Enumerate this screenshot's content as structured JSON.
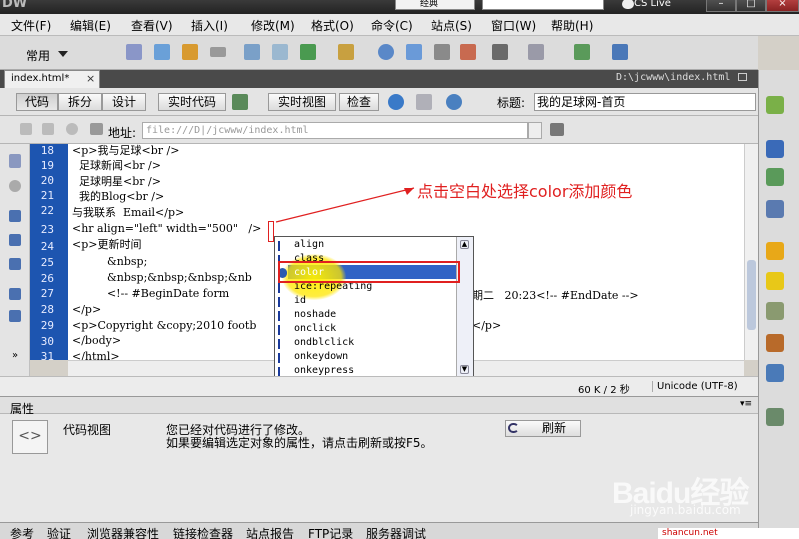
{
  "app": {
    "logo": "DW",
    "layout": "经典",
    "cs_live": "CS Live"
  },
  "menubar": [
    "文件(F)",
    "编辑(E)",
    "查看(V)",
    "插入(I)",
    "修改(M)",
    "格式(O)",
    "命令(C)",
    "站点(S)",
    "窗口(W)",
    "帮助(H)"
  ],
  "insert_bar": {
    "category": "常用"
  },
  "document": {
    "tab": "index.html*",
    "path": "D:\\jcwww\\index.html",
    "views": [
      "代码",
      "拆分",
      "设计",
      "实时代码",
      "实时视图",
      "检查"
    ],
    "title_label": "标题:",
    "title_value": "我的足球网-首页",
    "address_label": "地址:",
    "address_value": "file:///D|/jcwww/index.html"
  },
  "code": {
    "line_numbers": [
      "18",
      "19",
      "20",
      "21",
      "22",
      "23",
      "24",
      "25",
      "26",
      "27",
      "28",
      "29",
      "30",
      "31"
    ],
    "lines": [
      "<p>我与足球<br />",
      "  足球新闻<br />",
      "  足球明星<br />",
      "  我的Blog<br />",
      "与我联系  Email</p>",
      "<hr align=\"left\" width=\"500\"   />",
      "<p>更新时间",
      "          &nbsp;",
      "          &nbsp;&nbsp;&nbsp;&nb",
      "          <!-- #BeginDate form",
      "</p>",
      "<p>Copyright &copy;2010 footb",
      "</body>",
      "</html>"
    ],
    "line27_tail": "期二   20:23<!-- #EndDate -->",
    "line29_tail": "</p>"
  },
  "autocomplete": {
    "items": [
      "align",
      "class",
      "color",
      "ice:repeating",
      "id",
      "noshade",
      "onclick",
      "ondblclick",
      "onkeydown",
      "onkeypress"
    ],
    "selected": "color"
  },
  "annotation": "点击空白处选择color添加颜色",
  "status": {
    "size": "60 K / 2 秒",
    "encoding": "Unicode (UTF-8)"
  },
  "properties": {
    "title": "属性",
    "view_label": "代码视图",
    "message1": "您已经对代码进行了修改。",
    "message2": "如果要编辑选定对象的属性，请点击刷新或按F5。",
    "refresh": "刷新"
  },
  "results_tabs": [
    "参考",
    "验证",
    "浏览器兼容性",
    "链接检查器",
    "站点报告",
    "FTP记录",
    "服务器调试"
  ],
  "watermark": {
    "logo": "Baidu经验",
    "sub": "jingyan.baidu.com",
    "corner": "shancun.net"
  },
  "colors": {
    "gutter": "#1d55b0",
    "selection": "#3163c5",
    "annotation": "#e02020"
  }
}
